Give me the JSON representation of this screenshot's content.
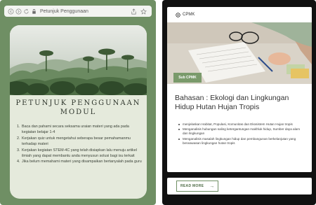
{
  "browser": {
    "title": "Petunjuk Penggunaan",
    "nav_icons": [
      "back-icon",
      "forward-icon",
      "reload-icon",
      "lock-icon"
    ],
    "action_icons": [
      "share-icon",
      "bookmark-star-icon"
    ]
  },
  "left_card": {
    "image": "forest-landscape",
    "title_line1": "PETUNJUK PENGGUNAAN",
    "title_line2": "MODUL",
    "instructions": [
      {
        "num": "1.",
        "text": "Baca dan pahami secara seksama uraian materi yang ada pada kegiatan belajar 1-4"
      },
      {
        "num": "2.",
        "text": "Kerjakan quiz untuk mengetahui seberapa besar pemahamanmu terhadap materi"
      },
      {
        "num": "3.",
        "text": "Kerjakan kegiatan STEM-4C yang telah disiapkan lalu menuju artikel ilmiah yang dapat membantu anda menyusun solusi bagi isu terkait"
      },
      {
        "num": "4.",
        "text": "Jika belum memahami materi yang disampaikan bertanyalah pada guru"
      }
    ]
  },
  "right_card": {
    "badge_top": "CPMK",
    "image": "person-studying-at-desk",
    "badge_sub": "Sub CPMK",
    "heading": "Bahasan : Ekologi dan Lingkungan Hidup Hutan Hujan Tropis",
    "bullets": [
      "menjelaskan Habitat, Populasi, Komunitas dan Ekosistem Hutan Hujan tropis",
      "Menganalisis hubungan saling ketergantungan makhluk hidup, Sumber daya alam dan lingkungan",
      "Menganalisis masalah lingkungan hidup dan pembangunan berkelanjutan yang berwawasan lingkungan hutan tropis"
    ],
    "read_more": "READ MORE",
    "read_more_arrow": "→"
  },
  "colors": {
    "sage_green": "#6f8f64",
    "card_bg": "#e5eadc",
    "right_bg": "#111111",
    "badge_green": "#7a9a6b"
  }
}
